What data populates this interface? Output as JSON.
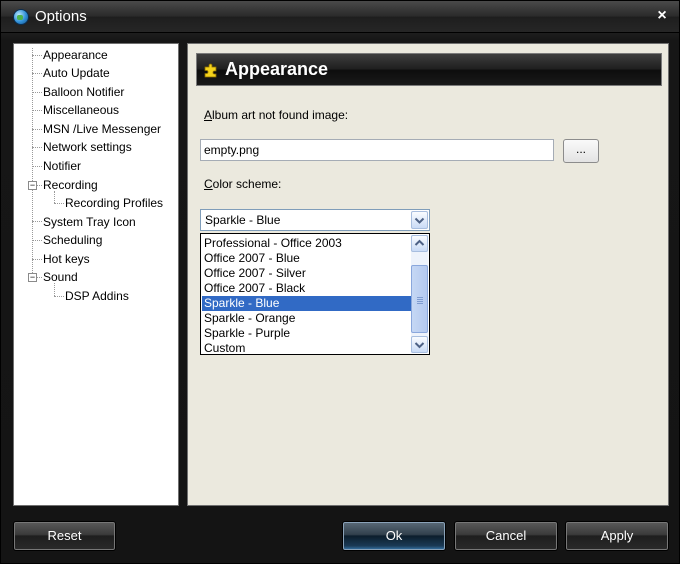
{
  "window": {
    "title": "Options",
    "close_glyph": "×"
  },
  "tree": {
    "items": [
      {
        "label": "Appearance"
      },
      {
        "label": "Auto Update"
      },
      {
        "label": "Balloon Notifier"
      },
      {
        "label": "Miscellaneous"
      },
      {
        "label": "MSN /Live Messenger"
      },
      {
        "label": "Network settings"
      },
      {
        "label": "Notifier"
      },
      {
        "label": "Recording",
        "expander": "−"
      },
      {
        "label": "Recording Profiles"
      },
      {
        "label": "System Tray Icon"
      },
      {
        "label": "Scheduling"
      },
      {
        "label": "Hot keys"
      },
      {
        "label": "Sound",
        "expander": "−"
      },
      {
        "label": "DSP Addins"
      }
    ]
  },
  "header": {
    "title": "Appearance",
    "icon": "puzzle-icon"
  },
  "album_art": {
    "label_accel": "A",
    "label_rest": "lbum art not found image:",
    "value": "empty.png",
    "browse_label": "..."
  },
  "color_scheme": {
    "label_accel": "C",
    "label_rest": "olor scheme:",
    "selected": "Sparkle - Blue",
    "options": [
      "Professional - Office 2003",
      "Office 2007 - Blue",
      "Office 2007 - Silver",
      "Office 2007 - Black",
      "Sparkle - Blue",
      "Sparkle - Orange",
      "Sparkle - Purple",
      "Custom"
    ],
    "selected_index": 4
  },
  "buttons": {
    "reset": "Reset",
    "ok": "Ok",
    "cancel": "Cancel",
    "apply": "Apply"
  },
  "colors": {
    "selection": "#316ac5",
    "content_bg": "#ebe9de",
    "window_bg": "#141414"
  }
}
